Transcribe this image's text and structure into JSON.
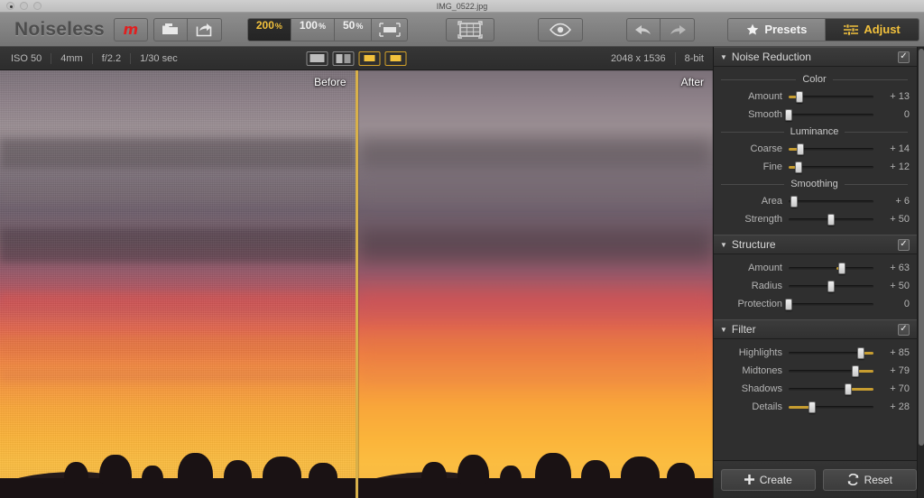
{
  "window": {
    "file_title": "IMG_0522.jpg",
    "app_name": "Noiseless",
    "logo_glyph": "m"
  },
  "toolbar": {
    "open_icon": "folder-icon",
    "share_icon": "share-icon",
    "zoom_levels": [
      {
        "label": "200",
        "suffix": "%",
        "active": true
      },
      {
        "label": "100",
        "suffix": "%",
        "active": false
      },
      {
        "label": "50",
        "suffix": "%",
        "active": false
      }
    ],
    "fit_label": "fit-to-screen-icon",
    "crop_label": "crop-grid-icon",
    "preview_label": "eye-preview-icon",
    "undo_label": "undo-icon",
    "redo_label": "redo-icon",
    "presets_label": "Presets",
    "adjust_label": "Adjust"
  },
  "infobar": {
    "exif": [
      "ISO 50",
      "4mm",
      "f/2.2",
      "1/30 sec"
    ],
    "dimensions": "2048 x 1536",
    "bit_depth": "8-bit",
    "view_modes": [
      "single-view",
      "split-view",
      "side-by-side-view"
    ],
    "active_view_mode": 2
  },
  "canvas": {
    "before_label": "Before",
    "after_label": "After",
    "divider_color": "#d8b04a"
  },
  "accent_color": "#f2c13c",
  "panel": {
    "sections": [
      {
        "title": "Noise Reduction",
        "enabled": true,
        "groups": [
          {
            "label": "Color",
            "sliders": [
              {
                "name": "Amount",
                "value": "+ 13",
                "pos": 13,
                "fill_from": "left"
              },
              {
                "name": "Smooth",
                "value": "0",
                "pos": 0,
                "fill_from": "none"
              }
            ]
          },
          {
            "label": "Luminance",
            "sliders": [
              {
                "name": "Coarse",
                "value": "+ 14",
                "pos": 14,
                "fill_from": "left"
              },
              {
                "name": "Fine",
                "value": "+ 12",
                "pos": 12,
                "fill_from": "left"
              }
            ]
          },
          {
            "label": "Smoothing",
            "sliders": [
              {
                "name": "Area",
                "value": "+ 6",
                "pos": 6,
                "fill_from": "none"
              },
              {
                "name": "Strength",
                "value": "+ 50",
                "pos": 50,
                "fill_from": "none"
              }
            ]
          }
        ]
      },
      {
        "title": "Structure",
        "enabled": true,
        "groups": [
          {
            "label": "",
            "sliders": [
              {
                "name": "Amount",
                "value": "+ 63",
                "pos": 63,
                "fill_from": "nub"
              },
              {
                "name": "Radius",
                "value": "+ 50",
                "pos": 50,
                "fill_from": "none"
              },
              {
                "name": "Protection",
                "value": "0",
                "pos": 0,
                "fill_from": "none"
              }
            ]
          }
        ]
      },
      {
        "title": "Filter",
        "enabled": true,
        "groups": [
          {
            "label": "",
            "sliders": [
              {
                "name": "Highlights",
                "value": "+ 85",
                "pos": 85,
                "fill_from": "right"
              },
              {
                "name": "Midtones",
                "value": "+ 79",
                "pos": 79,
                "fill_from": "right"
              },
              {
                "name": "Shadows",
                "value": "+ 70",
                "pos": 70,
                "fill_from": "right"
              },
              {
                "name": "Details",
                "value": "+ 28",
                "pos": 28,
                "fill_from": "left"
              }
            ]
          }
        ]
      }
    ],
    "footer": {
      "create_label": "Create",
      "reset_label": "Reset",
      "create_icon": "plus-icon",
      "reset_icon": "refresh-icon"
    }
  }
}
